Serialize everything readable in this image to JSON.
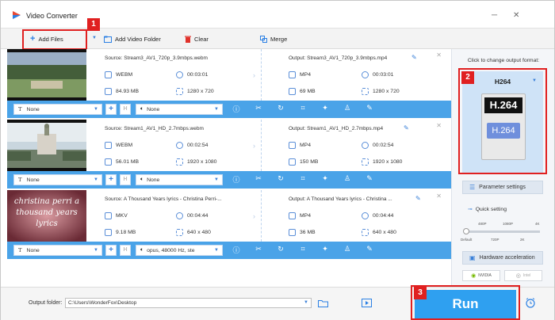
{
  "window": {
    "title": "Video Converter",
    "minimize": "─",
    "close": "✕"
  },
  "toolbar": {
    "add_files": "Add Files",
    "add_video_folder": "Add Video Folder",
    "clear": "Clear",
    "merge": "Merge"
  },
  "callouts": {
    "one": "1",
    "two": "2",
    "three": "3"
  },
  "items": [
    {
      "source": "Source: Stream3_AV1_720p_3.9mbps.webm",
      "src_format": "WEBM",
      "src_duration": "00:03:01",
      "src_size": "84.93 MB",
      "src_res": "1280 x 720",
      "output": "Output: Stream3_AV1_720p_3.9mbps.mp4",
      "out_format": "MP4",
      "out_duration": "00:03:01",
      "out_size": "69 MB",
      "out_res": "1280 x 720",
      "subtitle": "None",
      "audio": "None"
    },
    {
      "source": "Source: Stream1_AV1_HD_2.7mbps.webm",
      "src_format": "WEBM",
      "src_duration": "00:02:54",
      "src_size": "56.01 MB",
      "src_res": "1920 x 1080",
      "output": "Output: Stream1_AV1_HD_2.7mbps.mp4",
      "out_format": "MP4",
      "out_duration": "00:02:54",
      "out_size": "150 MB",
      "out_res": "1920 x 1080",
      "subtitle": "None",
      "audio": "None"
    },
    {
      "source": "Source: A Thousand Years lyrics - Christina Perri-...",
      "src_format": "MKV",
      "src_duration": "00:04:44",
      "src_size": "9.18 MB",
      "src_res": "640 x 480",
      "output": "Output: A Thousand Years lyrics - Christina ...",
      "out_format": "MP4",
      "out_duration": "00:04:44",
      "out_size": "36 MB",
      "out_res": "640 x 480",
      "subtitle": "None",
      "audio": "opus, 48000 Hz, ste",
      "thumb_text": "christina perri a thousand years lyrics"
    }
  ],
  "right_panel": {
    "title": "Click to change output format:",
    "format": "H264",
    "format_icon_top": "H.264",
    "format_icon_bottom": "H.264",
    "param_settings": "Parameter settings",
    "quick_setting": "Quick setting",
    "ticks_top": [
      "480P",
      "1080P",
      "4K"
    ],
    "ticks_bottom": [
      "Default",
      "720P",
      "2K"
    ],
    "quality_level": 0,
    "hw_accel": "Hardware acceleration",
    "nvidia": "NVIDIA",
    "intel": "Intel"
  },
  "bottom": {
    "output_folder_label": "Output folder:",
    "output_folder_value": "C:\\Users\\WonderFox\\Desktop",
    "run": "Run"
  },
  "colors": {
    "accent": "#4aa3e8",
    "run": "#2fa0f0",
    "callout": "#e02020"
  }
}
